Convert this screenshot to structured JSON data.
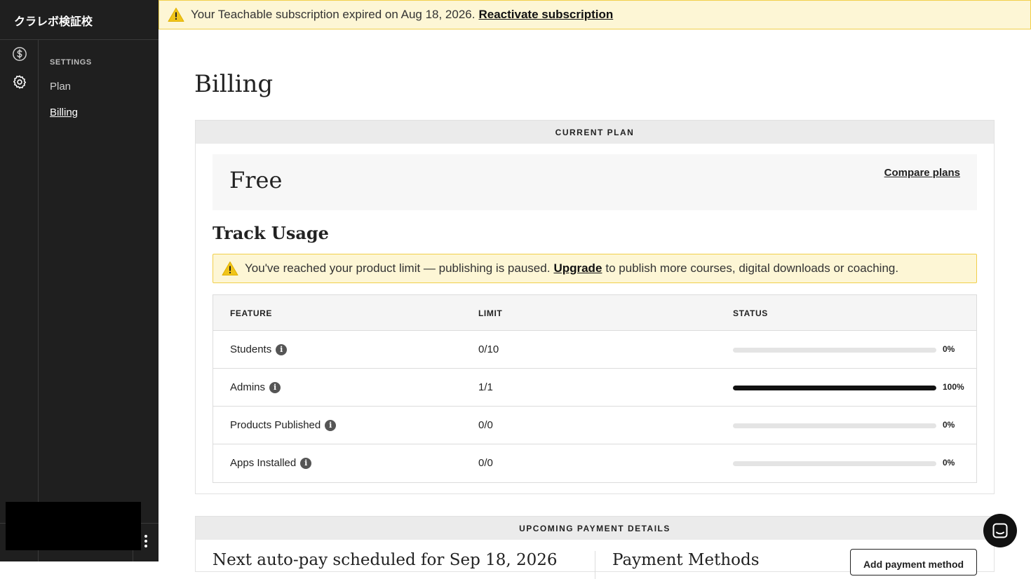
{
  "sidebar": {
    "school_name": "クラレボ検証校",
    "rail_icons": [
      "dollar-circle-icon",
      "gear-icon"
    ],
    "section_heading": "SETTINGS",
    "items": [
      {
        "label": "Plan",
        "active": false
      },
      {
        "label": "Billing",
        "active": true
      }
    ]
  },
  "banner": {
    "message": "Your Teachable subscription expired on Aug 18, 2026.",
    "link_label": "Reactivate subscription",
    "icon": "warning-triangle-icon"
  },
  "page": {
    "title": "Billing"
  },
  "current_plan": {
    "header": "CURRENT PLAN",
    "plan_name": "Free",
    "compare_label": "Compare plans",
    "track_usage_title": "Track Usage",
    "alert": {
      "text_before": "You've reached your product limit — publishing is paused.",
      "link_label": "Upgrade",
      "text_after": "to publish more courses, digital downloads or coaching."
    },
    "table": {
      "columns": [
        "FEATURE",
        "LIMIT",
        "STATUS"
      ],
      "rows": [
        {
          "feature": "Students",
          "limit": "0/10",
          "percent_label": "0%",
          "fill": 0
        },
        {
          "feature": "Admins",
          "limit": "1/1",
          "percent_label": "100%",
          "fill": 100
        },
        {
          "feature": "Products Published",
          "limit": "0/0",
          "percent_label": "0%",
          "fill": 0
        },
        {
          "feature": "Apps Installed",
          "limit": "0/0",
          "percent_label": "0%",
          "fill": 0
        }
      ]
    }
  },
  "upcoming_payment": {
    "header": "UPCOMING PAYMENT DETAILS",
    "next_pay": "Next auto-pay scheduled for Sep 18, 2026",
    "payment_methods_title": "Payment Methods",
    "add_payment_label": "Add payment method"
  },
  "colors": {
    "sidebar_bg": "#1f1f1f",
    "alert_bg": "#fdf6d5",
    "alert_border": "#f1cf4b",
    "warning_icon": "#f0c419",
    "progress_fill": "#111111"
  }
}
